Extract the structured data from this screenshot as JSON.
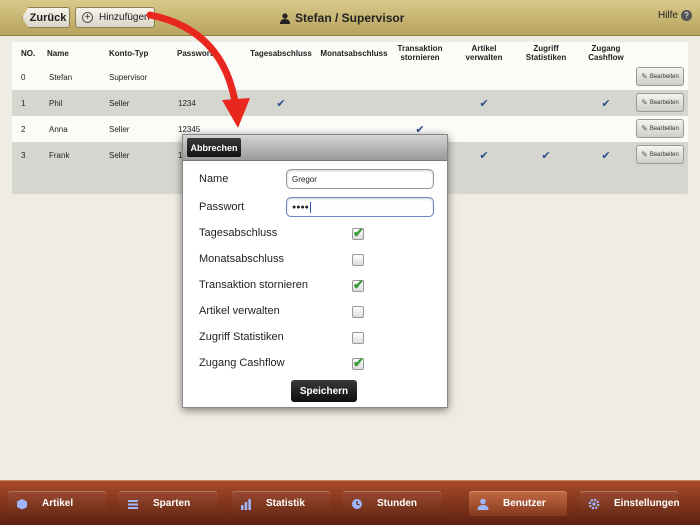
{
  "topbar": {
    "back_label": "Zurück",
    "add_label": "Hinzufügen",
    "title": "Stefan / Supervisor",
    "help_label": "Hilfe"
  },
  "table": {
    "headers": [
      "NO.",
      "Name",
      "Konto-Typ",
      "Passwort",
      "Tagesabschluss",
      "Monatsabschluss",
      "Transaktion stornieren",
      "Artikel verwalten",
      "Zugriff Statistiken",
      "Zugang Cashflow"
    ],
    "rows": [
      {
        "no": "0",
        "name": "Stefan",
        "type": "Supervisor",
        "password": "",
        "checks": [
          false,
          false,
          false,
          false,
          false,
          false
        ],
        "edit": "Bearbeiten"
      },
      {
        "no": "1",
        "name": "Phil",
        "type": "Seller",
        "password": "1234",
        "checks": [
          true,
          false,
          false,
          true,
          false,
          true
        ],
        "edit": "Bearbeiten"
      },
      {
        "no": "2",
        "name": "Anna",
        "type": "Seller",
        "password": "12345",
        "checks": [
          false,
          false,
          true,
          false,
          false,
          false
        ],
        "edit": "Bearbeiten"
      },
      {
        "no": "3",
        "name": "Frank",
        "type": "Seller",
        "password": "1",
        "checks": [
          false,
          false,
          false,
          true,
          true,
          true
        ],
        "edit": "Bearbeiten"
      }
    ]
  },
  "popup": {
    "cancel_label": "Abbrechen",
    "name_label": "Name",
    "name_value": "Gregor",
    "password_label": "Passwort",
    "password_value": "●●●●",
    "options": [
      {
        "label": "Tagesabschluss",
        "checked": true
      },
      {
        "label": "Monatsabschluss",
        "checked": false
      },
      {
        "label": "Transaktion stornieren",
        "checked": true
      },
      {
        "label": "Artikel verwalten",
        "checked": false
      },
      {
        "label": "Zugriff Statistiken",
        "checked": false
      },
      {
        "label": "Zugang Cashflow",
        "checked": true
      }
    ],
    "save_label": "Speichern"
  },
  "nav": {
    "tabs": [
      {
        "label": "Artikel",
        "icon": "box-icon",
        "active": false
      },
      {
        "label": "Sparten",
        "icon": "list-icon",
        "active": false
      },
      {
        "label": "Statistik",
        "icon": "bar-chart-icon",
        "active": false
      },
      {
        "label": "Stunden",
        "icon": "clock-icon",
        "active": false
      },
      {
        "label": "Benutzer",
        "icon": "user-icon",
        "active": true
      },
      {
        "label": "Einstellungen",
        "icon": "gear-icon",
        "active": false
      }
    ]
  },
  "colors": {
    "topbar": "#c9b673",
    "bottombar": "#7a3218",
    "check": "#2b4e8c",
    "popup_check": "#2aa02a"
  }
}
